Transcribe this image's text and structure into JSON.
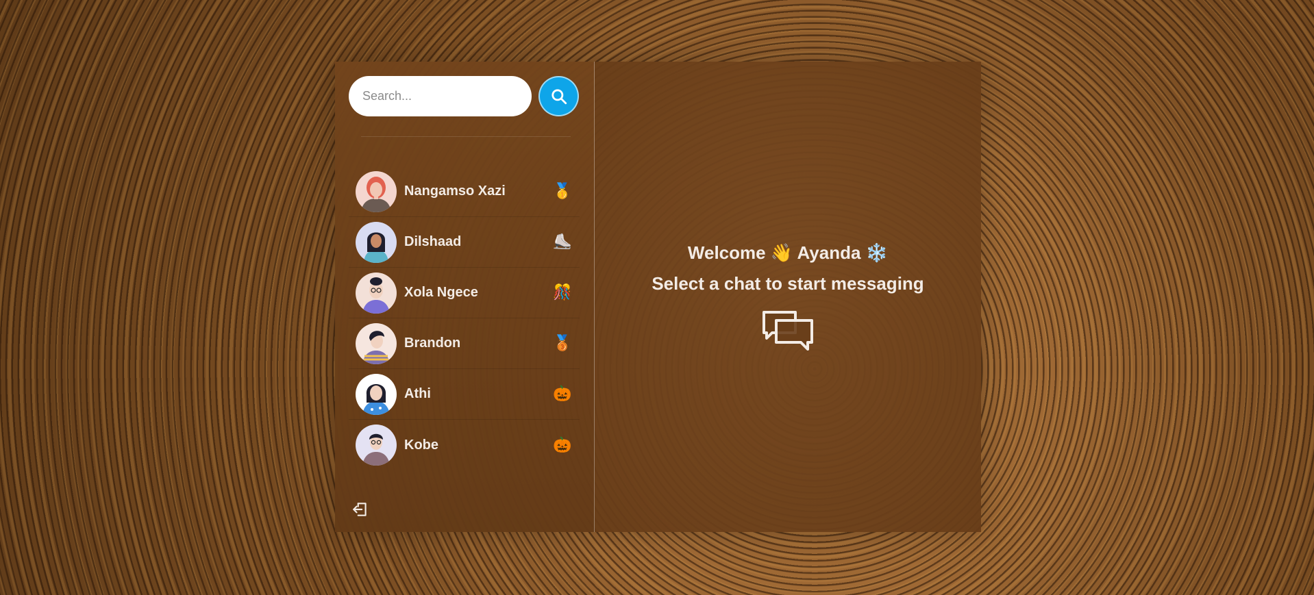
{
  "search": {
    "placeholder": "Search..."
  },
  "contacts": [
    {
      "name": "Nangamso Xazi",
      "status_emoji": "🥇",
      "avatar": "person-avatar"
    },
    {
      "name": "Dilshaad",
      "status_emoji": "⛸️",
      "avatar": "person-avatar"
    },
    {
      "name": "Xola Ngece",
      "status_emoji": "🎊",
      "avatar": "person-avatar"
    },
    {
      "name": "Brandon",
      "status_emoji": "🥉",
      "avatar": "person-avatar"
    },
    {
      "name": "Athi",
      "status_emoji": "🎃",
      "avatar": "person-avatar"
    },
    {
      "name": "Kobe",
      "status_emoji": "🎃",
      "avatar": "person-avatar"
    }
  ],
  "welcome": {
    "prefix": "Welcome",
    "wave_emoji": "👋",
    "username": "Ayanda",
    "suffix_emoji": "❄️",
    "subtitle": "Select a chat to start messaging"
  },
  "icons": {
    "search": "search-icon",
    "logout": "logout-icon",
    "chat": "chat-bubbles-icon"
  },
  "colors": {
    "accent": "#0ea5e9",
    "text": "#f3ece6",
    "panel": "#693e19"
  }
}
